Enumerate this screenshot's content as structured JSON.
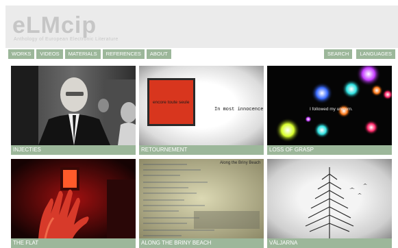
{
  "header": {
    "logo": "eLMcip",
    "tagline": "Anthology of European Electronic Literature"
  },
  "nav": {
    "left": [
      "WORKS",
      "VIDEOS",
      "MATERIALS",
      "REFERENCES",
      "ABOUT"
    ],
    "right": [
      "SEARCH",
      "LANGUAGES"
    ]
  },
  "tiles": [
    {
      "caption": "INJECTIES"
    },
    {
      "caption": "RETOURNEMENT",
      "overlay_left": "encore toute seule",
      "overlay_right": "In most innocence"
    },
    {
      "caption": "LOSS OF GRASP",
      "overlay": "I followed my unicorn."
    },
    {
      "caption": "THE FLAT"
    },
    {
      "caption": "ALONG THE BRINY BEACH",
      "title": "Along the Briny Beach"
    },
    {
      "caption": "VÄLJARNA"
    }
  ],
  "colors": {
    "header_bg": "#ebebeb",
    "accent_green": "#9cb79a",
    "logo_gray": "#c6c6c6"
  }
}
